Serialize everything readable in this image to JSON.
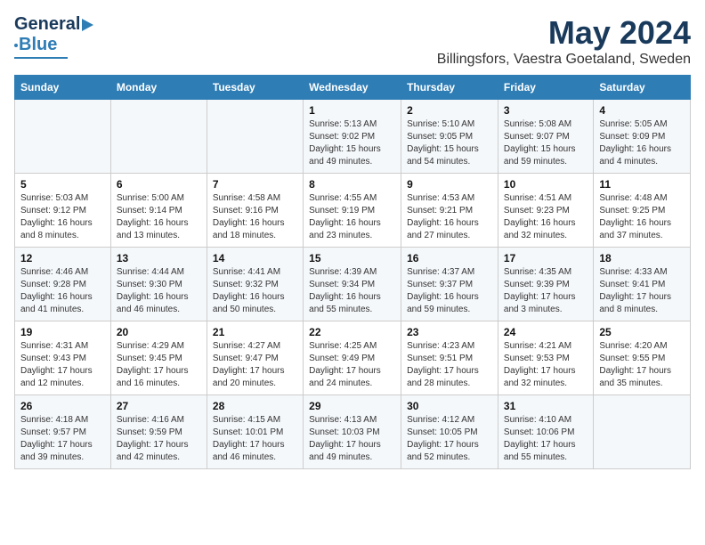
{
  "logo": {
    "line1": "General",
    "line2": "Blue"
  },
  "title": "May 2024",
  "location": "Billingsfors, Vaestra Goetaland, Sweden",
  "days_header": [
    "Sunday",
    "Monday",
    "Tuesday",
    "Wednesday",
    "Thursday",
    "Friday",
    "Saturday"
  ],
  "weeks": [
    [
      {
        "day": "",
        "detail": ""
      },
      {
        "day": "",
        "detail": ""
      },
      {
        "day": "",
        "detail": ""
      },
      {
        "day": "1",
        "detail": "Sunrise: 5:13 AM\nSunset: 9:02 PM\nDaylight: 15 hours\nand 49 minutes."
      },
      {
        "day": "2",
        "detail": "Sunrise: 5:10 AM\nSunset: 9:05 PM\nDaylight: 15 hours\nand 54 minutes."
      },
      {
        "day": "3",
        "detail": "Sunrise: 5:08 AM\nSunset: 9:07 PM\nDaylight: 15 hours\nand 59 minutes."
      },
      {
        "day": "4",
        "detail": "Sunrise: 5:05 AM\nSunset: 9:09 PM\nDaylight: 16 hours\nand 4 minutes."
      }
    ],
    [
      {
        "day": "5",
        "detail": "Sunrise: 5:03 AM\nSunset: 9:12 PM\nDaylight: 16 hours\nand 8 minutes."
      },
      {
        "day": "6",
        "detail": "Sunrise: 5:00 AM\nSunset: 9:14 PM\nDaylight: 16 hours\nand 13 minutes."
      },
      {
        "day": "7",
        "detail": "Sunrise: 4:58 AM\nSunset: 9:16 PM\nDaylight: 16 hours\nand 18 minutes."
      },
      {
        "day": "8",
        "detail": "Sunrise: 4:55 AM\nSunset: 9:19 PM\nDaylight: 16 hours\nand 23 minutes."
      },
      {
        "day": "9",
        "detail": "Sunrise: 4:53 AM\nSunset: 9:21 PM\nDaylight: 16 hours\nand 27 minutes."
      },
      {
        "day": "10",
        "detail": "Sunrise: 4:51 AM\nSunset: 9:23 PM\nDaylight: 16 hours\nand 32 minutes."
      },
      {
        "day": "11",
        "detail": "Sunrise: 4:48 AM\nSunset: 9:25 PM\nDaylight: 16 hours\nand 37 minutes."
      }
    ],
    [
      {
        "day": "12",
        "detail": "Sunrise: 4:46 AM\nSunset: 9:28 PM\nDaylight: 16 hours\nand 41 minutes."
      },
      {
        "day": "13",
        "detail": "Sunrise: 4:44 AM\nSunset: 9:30 PM\nDaylight: 16 hours\nand 46 minutes."
      },
      {
        "day": "14",
        "detail": "Sunrise: 4:41 AM\nSunset: 9:32 PM\nDaylight: 16 hours\nand 50 minutes."
      },
      {
        "day": "15",
        "detail": "Sunrise: 4:39 AM\nSunset: 9:34 PM\nDaylight: 16 hours\nand 55 minutes."
      },
      {
        "day": "16",
        "detail": "Sunrise: 4:37 AM\nSunset: 9:37 PM\nDaylight: 16 hours\nand 59 minutes."
      },
      {
        "day": "17",
        "detail": "Sunrise: 4:35 AM\nSunset: 9:39 PM\nDaylight: 17 hours\nand 3 minutes."
      },
      {
        "day": "18",
        "detail": "Sunrise: 4:33 AM\nSunset: 9:41 PM\nDaylight: 17 hours\nand 8 minutes."
      }
    ],
    [
      {
        "day": "19",
        "detail": "Sunrise: 4:31 AM\nSunset: 9:43 PM\nDaylight: 17 hours\nand 12 minutes."
      },
      {
        "day": "20",
        "detail": "Sunrise: 4:29 AM\nSunset: 9:45 PM\nDaylight: 17 hours\nand 16 minutes."
      },
      {
        "day": "21",
        "detail": "Sunrise: 4:27 AM\nSunset: 9:47 PM\nDaylight: 17 hours\nand 20 minutes."
      },
      {
        "day": "22",
        "detail": "Sunrise: 4:25 AM\nSunset: 9:49 PM\nDaylight: 17 hours\nand 24 minutes."
      },
      {
        "day": "23",
        "detail": "Sunrise: 4:23 AM\nSunset: 9:51 PM\nDaylight: 17 hours\nand 28 minutes."
      },
      {
        "day": "24",
        "detail": "Sunrise: 4:21 AM\nSunset: 9:53 PM\nDaylight: 17 hours\nand 32 minutes."
      },
      {
        "day": "25",
        "detail": "Sunrise: 4:20 AM\nSunset: 9:55 PM\nDaylight: 17 hours\nand 35 minutes."
      }
    ],
    [
      {
        "day": "26",
        "detail": "Sunrise: 4:18 AM\nSunset: 9:57 PM\nDaylight: 17 hours\nand 39 minutes."
      },
      {
        "day": "27",
        "detail": "Sunrise: 4:16 AM\nSunset: 9:59 PM\nDaylight: 17 hours\nand 42 minutes."
      },
      {
        "day": "28",
        "detail": "Sunrise: 4:15 AM\nSunset: 10:01 PM\nDaylight: 17 hours\nand 46 minutes."
      },
      {
        "day": "29",
        "detail": "Sunrise: 4:13 AM\nSunset: 10:03 PM\nDaylight: 17 hours\nand 49 minutes."
      },
      {
        "day": "30",
        "detail": "Sunrise: 4:12 AM\nSunset: 10:05 PM\nDaylight: 17 hours\nand 52 minutes."
      },
      {
        "day": "31",
        "detail": "Sunrise: 4:10 AM\nSunset: 10:06 PM\nDaylight: 17 hours\nand 55 minutes."
      },
      {
        "day": "",
        "detail": ""
      }
    ]
  ]
}
